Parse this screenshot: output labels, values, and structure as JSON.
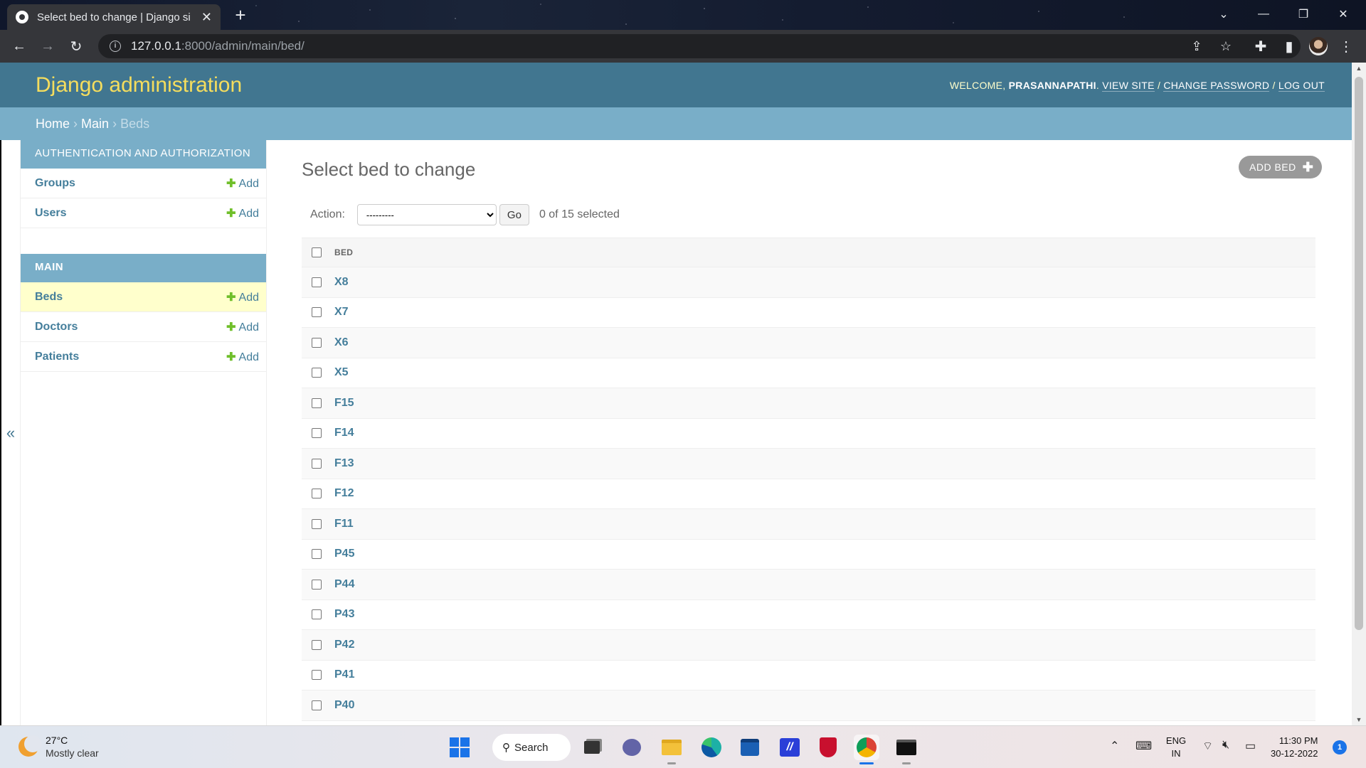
{
  "browser": {
    "tab_title": "Select bed to change | Django si",
    "url_host": "127.0.0.1",
    "url_path": ":8000/admin/main/bed/"
  },
  "header": {
    "site_name": "Django administration",
    "welcome": "WELCOME, ",
    "username": "PRASANNAPATHI",
    "view_site": "VIEW SITE",
    "change_password": "CHANGE PASSWORD",
    "log_out": "LOG OUT",
    "sep": "/"
  },
  "breadcrumbs": {
    "home": "Home",
    "app": "Main",
    "current": "Beds",
    "sep": "›"
  },
  "sidebar": {
    "toggle": "«",
    "modules": [
      {
        "caption": "AUTHENTICATION AND AUTHORIZATION",
        "items": [
          {
            "name": "Groups",
            "add": "Add"
          },
          {
            "name": "Users",
            "add": "Add"
          }
        ]
      },
      {
        "caption": "MAIN",
        "items": [
          {
            "name": "Beds",
            "add": "Add"
          },
          {
            "name": "Doctors",
            "add": "Add"
          },
          {
            "name": "Patients",
            "add": "Add"
          }
        ]
      }
    ]
  },
  "content": {
    "title": "Select bed to change",
    "add_button": "ADD BED",
    "action_label": "Action:",
    "action_selected": "---------",
    "go_label": "Go",
    "counter": "0 of 15 selected",
    "column_header": "BED",
    "rows": [
      "X8",
      "X7",
      "X6",
      "X5",
      "F15",
      "F14",
      "F13",
      "F12",
      "F11",
      "P45",
      "P44",
      "P43",
      "P42",
      "P41",
      "P40"
    ]
  },
  "taskbar": {
    "temperature": "27°C",
    "weather": "Mostly clear",
    "search_label": "Search",
    "lang_top": "ENG",
    "lang_bottom": "IN",
    "time": "11:30 PM",
    "date": "30-12-2022",
    "notifications": "1"
  },
  "colors": {
    "header_bg": "#417690",
    "breadcrumb_bg": "#79aec8",
    "brand_yellow": "#f5dd5d",
    "link_blue": "#447e9b",
    "add_green": "#70bf2b",
    "selected_row": "#ffffcc"
  }
}
